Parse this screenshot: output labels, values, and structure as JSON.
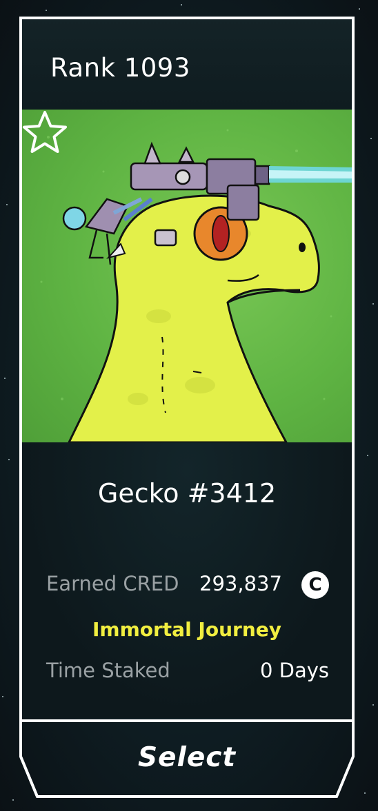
{
  "card": {
    "rank_label": "Rank 1093",
    "name": "Gecko #3412",
    "earned_label": "Earned CRED",
    "earned_value": "293,837",
    "cred_icon": "C",
    "journey": "Immortal Journey",
    "staked_label": "Time Staked",
    "staked_value": "0 Days",
    "select_label": "Select",
    "favorite_icon": "star-outline-icon"
  },
  "colors": {
    "frame": "#ffffff",
    "journey": "#f1ee40",
    "art_background": "#5fb443",
    "gecko_skin": "#e3f04a",
    "eye": "#e8872c",
    "muted_text": "#9aa1a4"
  }
}
